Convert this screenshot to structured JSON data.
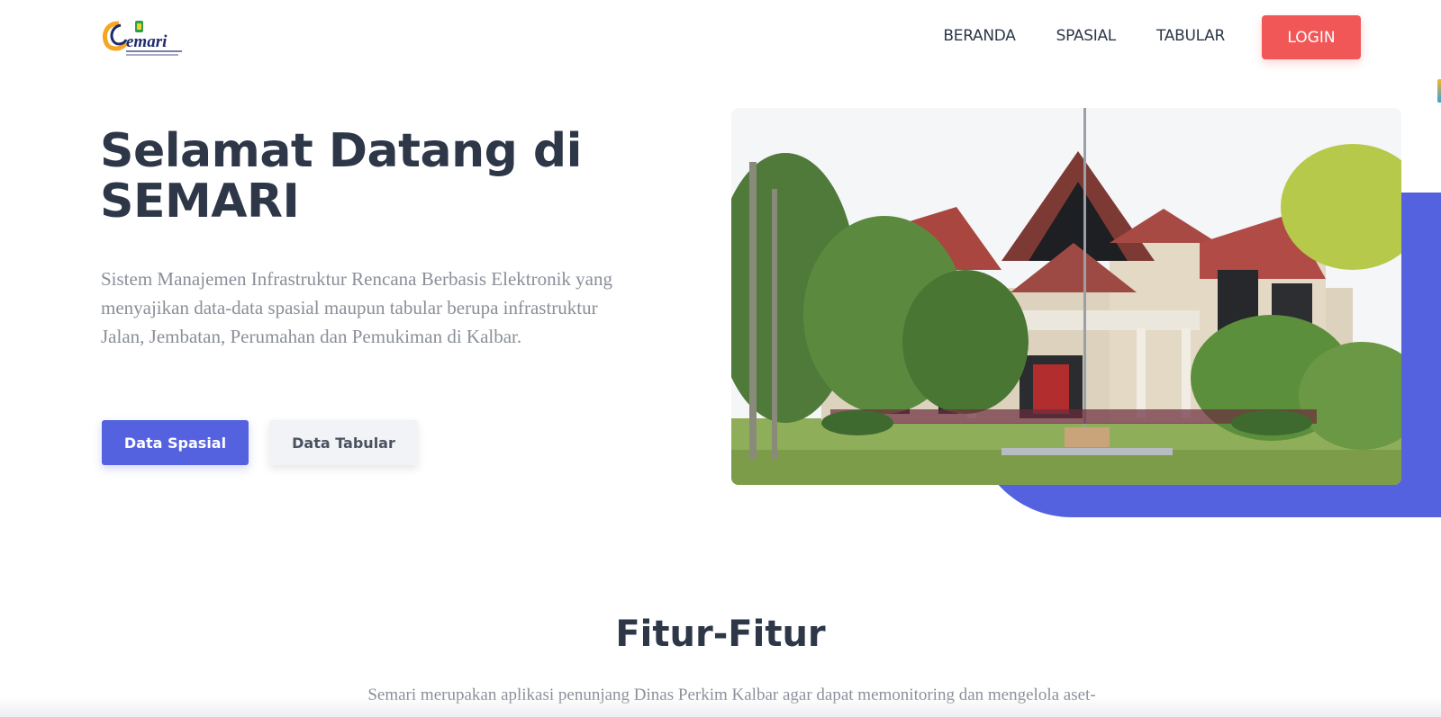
{
  "navbar": {
    "logo_text": "Semari",
    "logo_subtitle": "SISTEM MANAJEMEN INFRASTRUKTUR RENCANA BERBASIS ELEKTRONIK",
    "links": [
      "BERANDA",
      "SPASIAL",
      "TABULAR"
    ],
    "login_label": "LOGIN"
  },
  "hero": {
    "title": "Selamat Datang di SEMARI",
    "description": "Sistem Manajemen Infrastruktur Rencana Berbasis Elektronik yang menyajikan data-data spasial maupun tabular berupa infrastruktur Jalan, Jembatan, Perumahan dan Pemukiman di Kalbar.",
    "primary_button": "Data Spasial",
    "secondary_button": "Data Tabular"
  },
  "features": {
    "title": "Fitur-Fitur",
    "description": "Semari merupakan aplikasi penunjang Dinas Perkim Kalbar agar dapat memonitoring dan mengelola aset-"
  },
  "colors": {
    "primary": "#5562e0",
    "login": "#f25757",
    "heading": "#2d3748",
    "muted": "#8a8f98"
  }
}
